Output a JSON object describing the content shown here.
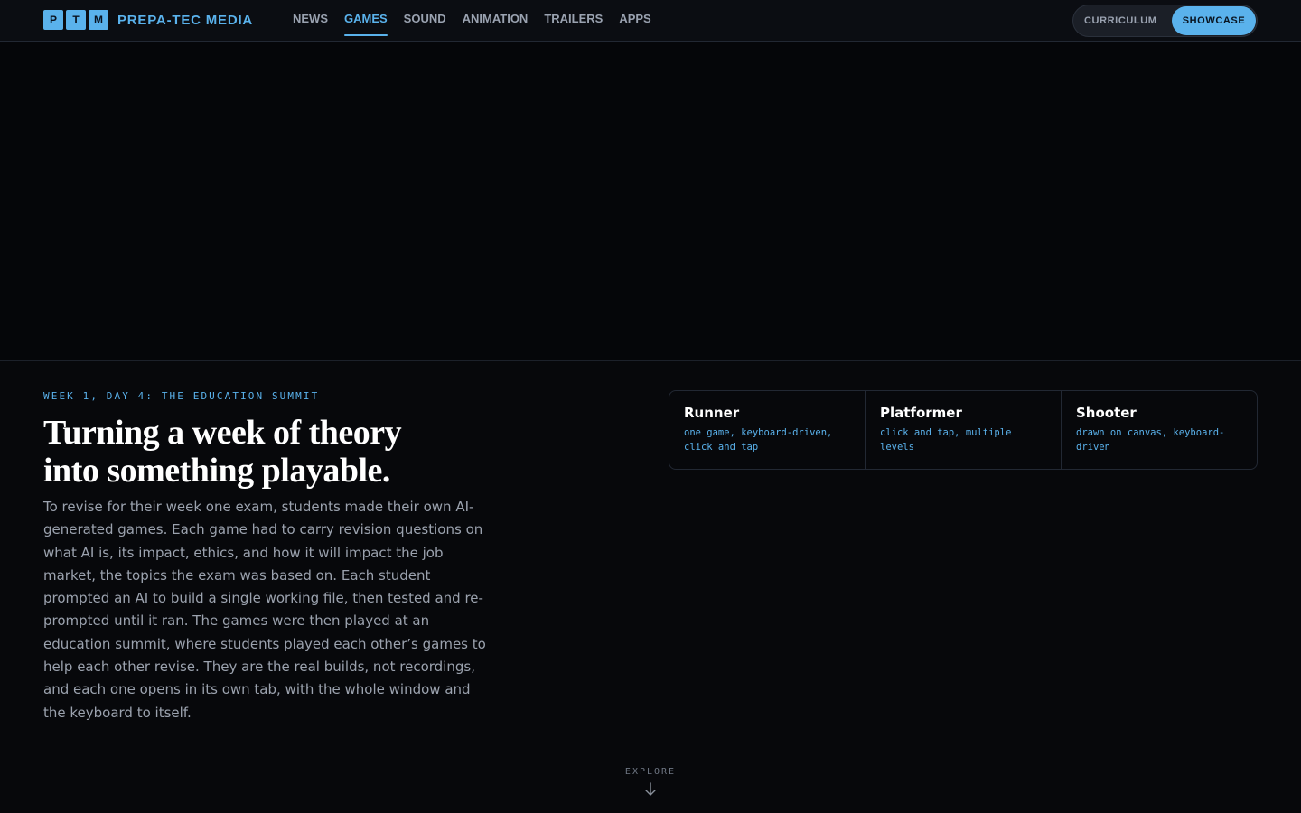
{
  "brand": {
    "tiles": [
      "P",
      "T",
      "M"
    ],
    "name": "PREPA-TEC MEDIA",
    "accent": "#5ab2ec"
  },
  "nav": {
    "items": [
      {
        "label": "NEWS",
        "active": false
      },
      {
        "label": "GAMES",
        "active": true
      },
      {
        "label": "SOUND",
        "active": false
      },
      {
        "label": "ANIMATION",
        "active": false
      },
      {
        "label": "TRAILERS",
        "active": false
      },
      {
        "label": "APPS",
        "active": false
      }
    ],
    "toggle": {
      "options": [
        "CURRICULUM",
        "SHOWCASE"
      ],
      "selected": "SHOWCASE"
    }
  },
  "intro": {
    "eyebrow": "WEEK 1, DAY 4: THE EDUCATION SUMMIT",
    "headline_line1": "Turning a week of theory",
    "headline_line2": "into something playable.",
    "body": "To revise for their week one exam, students made their own AI-generated games. Each game had to carry revision questions on what AI is, its impact, ethics, and how it will impact the job market, the topics the exam was based on. Each student prompted an AI to build a single working file, then tested and re-prompted until it ran. The games were then played at an education summit, where students played each other’s games to help each other revise. They are the real builds, not recordings, and each one opens in its own tab, with the whole window and the keyboard to itself."
  },
  "games": [
    {
      "title": "Runner",
      "desc": "one game, keyboard-driven, click and tap"
    },
    {
      "title": "Platformer",
      "desc": "click and tap, multiple levels"
    },
    {
      "title": "Shooter",
      "desc": "drawn on canvas, keyboard-driven"
    }
  ],
  "explore": {
    "label": "EXPLORE",
    "icon": "arrow-down-icon"
  },
  "colors": {
    "background": "#07080b",
    "accent": "#5ab2ec",
    "muted_text": "#9ba2ae"
  }
}
